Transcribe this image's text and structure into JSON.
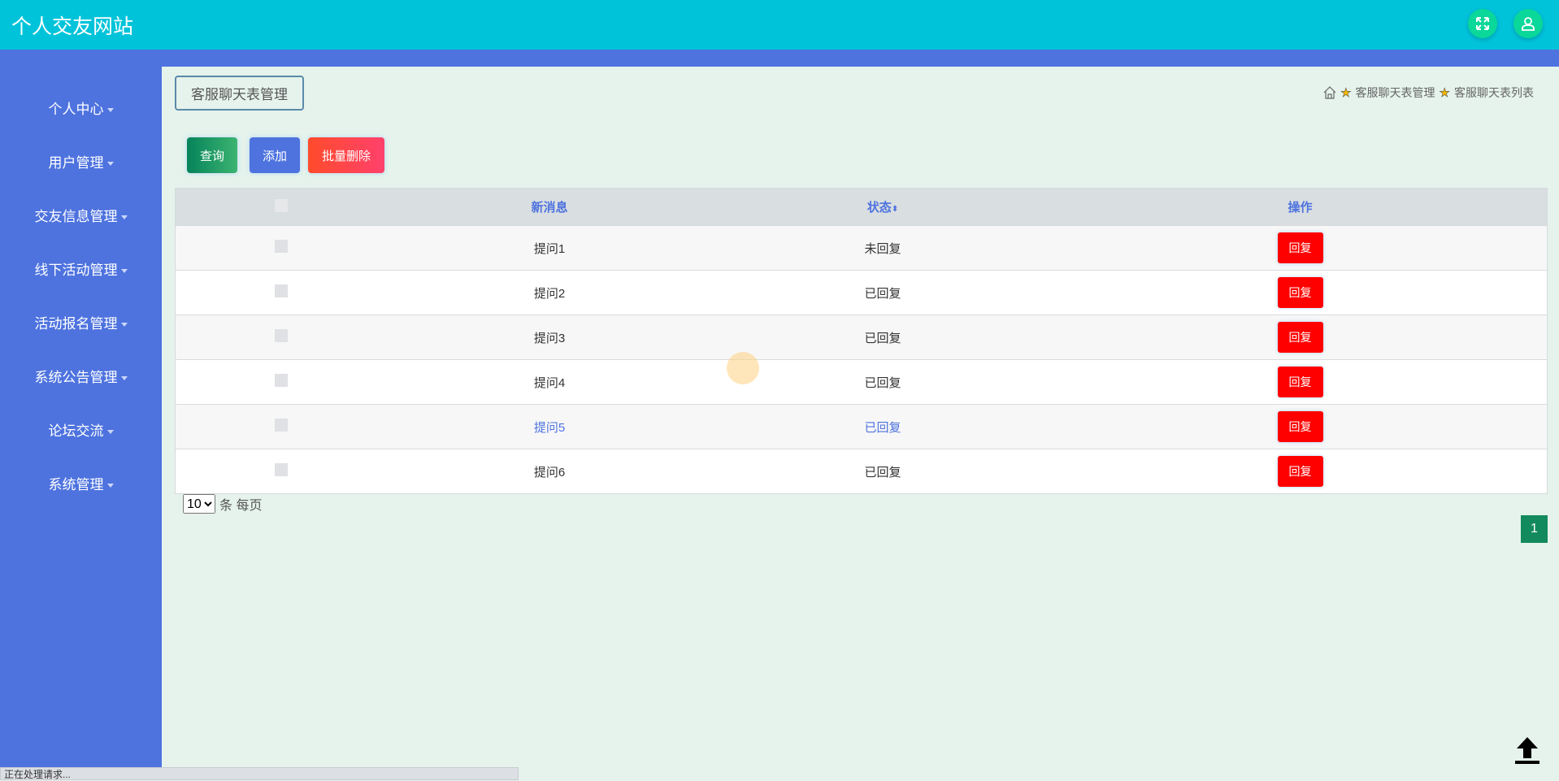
{
  "header": {
    "title": "个人交友网站",
    "fullscreen_icon": "expand-icon",
    "user_icon": "user-icon"
  },
  "sidebar": {
    "items": [
      {
        "label": "个人中心"
      },
      {
        "label": "用户管理"
      },
      {
        "label": "交友信息管理"
      },
      {
        "label": "线下活动管理"
      },
      {
        "label": "活动报名管理"
      },
      {
        "label": "系统公告管理"
      },
      {
        "label": "论坛交流"
      },
      {
        "label": "系统管理"
      }
    ]
  },
  "page": {
    "title": "客服聊天表管理",
    "breadcrumb": [
      "客服聊天表管理",
      "客服聊天表列表"
    ]
  },
  "toolbar": {
    "query": "查询",
    "add": "添加",
    "batch_delete": "批量删除"
  },
  "table": {
    "headers": {
      "message": "新消息",
      "status": "状态",
      "actions": "操作"
    },
    "rows": [
      {
        "message": "提问1",
        "status": "未回复",
        "action": "回复"
      },
      {
        "message": "提问2",
        "status": "已回复",
        "action": "回复"
      },
      {
        "message": "提问3",
        "status": "已回复",
        "action": "回复"
      },
      {
        "message": "提问4",
        "status": "已回复",
        "action": "回复"
      },
      {
        "message": "提问5",
        "status": "已回复",
        "action": "回复"
      },
      {
        "message": "提问6",
        "status": "已回复",
        "action": "回复"
      }
    ]
  },
  "pagination": {
    "page_size": "10",
    "per_page_label": "条 每页",
    "current_page": "1"
  },
  "statusbar": {
    "text": "正在处理请求..."
  },
  "colors": {
    "header": "#00c3da",
    "sidebar": "#4e73df",
    "reply": "#ff0000"
  }
}
